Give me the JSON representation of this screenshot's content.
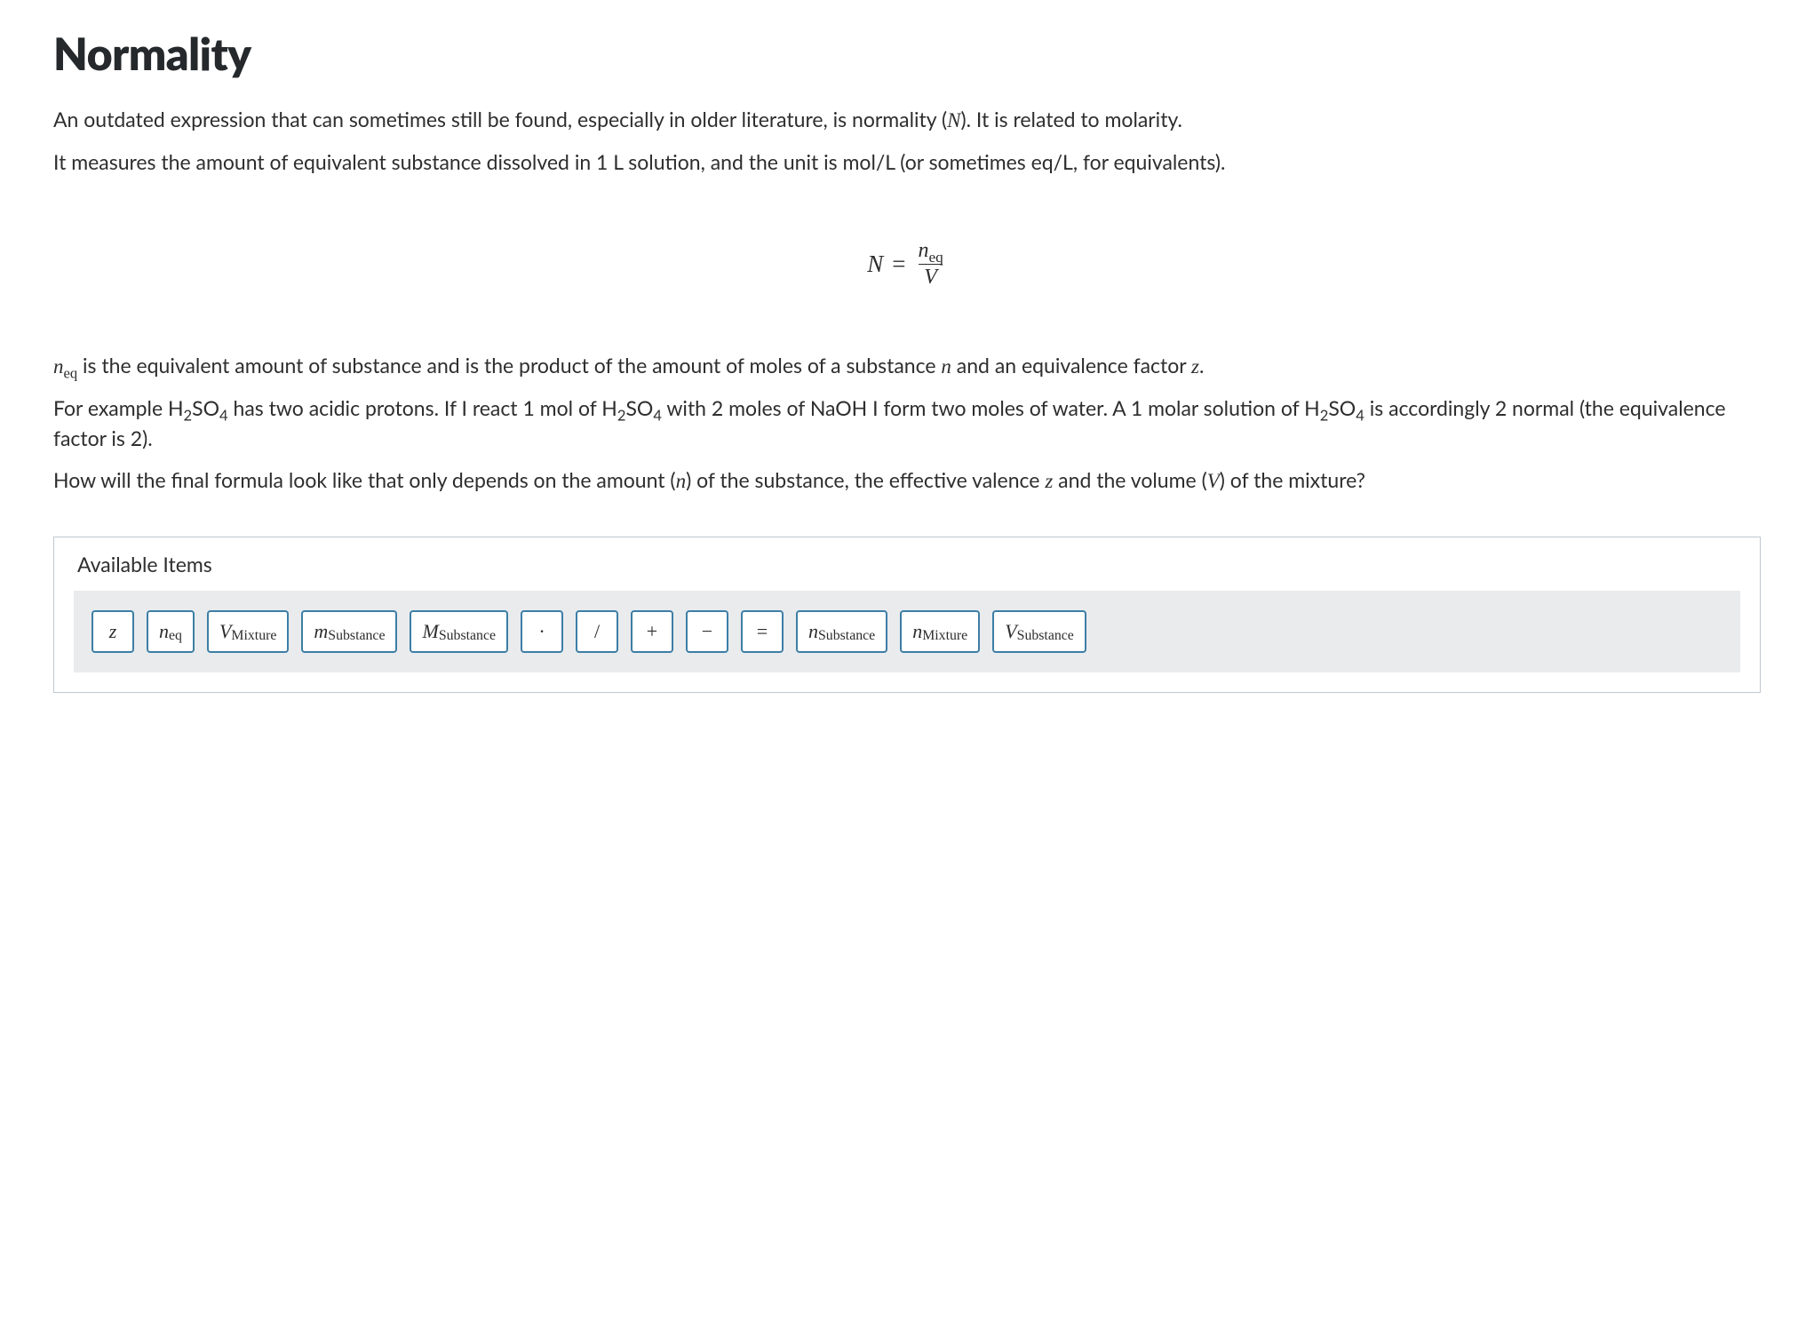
{
  "title": "Normality",
  "para1_a": "An outdated expression that can sometimes still be found, especially in older literature, is normality (",
  "para1_b": "). It is related to molarity.",
  "para2": "It measures the amount of equivalent substance dissolved in 1 L solution, and the unit is mol/L (or sometimes eq/L, for equivalents).",
  "formula": {
    "lhs_var": "N",
    "equals": "=",
    "num_var": "n",
    "num_sub": "eq",
    "den_var": "V"
  },
  "para3_a": " is the equivalent amount of substance and is the product of the amount of moles of a substance ",
  "para3_b": " and an equivalence factor ",
  "para3_c": ".",
  "neq_var": "n",
  "neq_sub": "eq",
  "n_var": "n",
  "z_var": "z",
  "para4_a": "For example H",
  "para4_b": "SO",
  "para4_c": " has two acidic protons. If I react 1 mol of H",
  "para4_d": "SO",
  "para4_e": " with 2 moles of NaOH I form two moles of water. A 1 molar solution of H",
  "para4_f": "SO",
  "para4_g": " is accordingly 2 normal (the equivalence factor is 2).",
  "sub2": "2",
  "sub4": "4",
  "para5_a": "How will the final formula look like that only depends on the amount (",
  "para5_b": ") of the substance, the effective valence ",
  "para5_c": " and the volume (",
  "para5_d": ") of the mixture?",
  "V_var": "V",
  "panel": {
    "title": "Available Items",
    "items": [
      {
        "kind": "var",
        "main": "z",
        "sub": ""
      },
      {
        "kind": "var",
        "main": "n",
        "sub": "eq"
      },
      {
        "kind": "var",
        "main": "V",
        "sub": "Mixture"
      },
      {
        "kind": "var",
        "main": "m",
        "sub": "Substance"
      },
      {
        "kind": "var",
        "main": "M",
        "sub": "Substance"
      },
      {
        "kind": "op",
        "main": "·",
        "sub": ""
      },
      {
        "kind": "op",
        "main": "/",
        "sub": ""
      },
      {
        "kind": "op",
        "main": "+",
        "sub": ""
      },
      {
        "kind": "op",
        "main": "−",
        "sub": ""
      },
      {
        "kind": "op",
        "main": "=",
        "sub": ""
      },
      {
        "kind": "var",
        "main": "n",
        "sub": "Substance"
      },
      {
        "kind": "var",
        "main": "n",
        "sub": "Mixture"
      },
      {
        "kind": "var",
        "main": "V",
        "sub": "Substance"
      }
    ]
  }
}
